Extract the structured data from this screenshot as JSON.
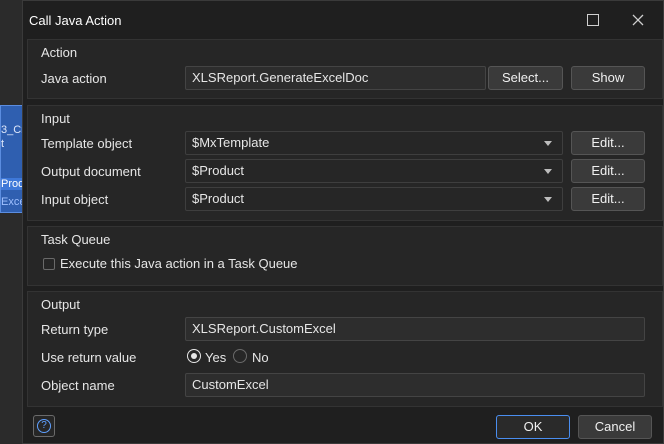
{
  "background_app": {
    "node_text_1": "3_Cre",
    "node_text_2": "t",
    "node_text_3": "Prod",
    "node_text_4": "Excel"
  },
  "window": {
    "title": "Call Java Action"
  },
  "action": {
    "group_title": "Action",
    "java_action_label": "Java action",
    "java_action_value": "XLSReport.GenerateExcelDoc",
    "select_button": "Select...",
    "show_button": "Show"
  },
  "input": {
    "group_title": "Input",
    "rows": [
      {
        "label": "Template object",
        "value": "$MxTemplate",
        "edit": "Edit..."
      },
      {
        "label": "Output document",
        "value": "$Product",
        "edit": "Edit..."
      },
      {
        "label": "Input object",
        "value": "$Product",
        "edit": "Edit..."
      }
    ]
  },
  "task_queue": {
    "group_title": "Task Queue",
    "checkbox_label": "Execute this Java action in a Task Queue"
  },
  "output": {
    "group_title": "Output",
    "return_type_label": "Return type",
    "return_type_value": "XLSReport.CustomExcel",
    "use_return_label": "Use return value",
    "yes_label": "Yes",
    "no_label": "No",
    "selected": "Yes",
    "object_name_label": "Object name",
    "object_name_value": "CustomExcel"
  },
  "footer": {
    "help_glyph": "?",
    "ok_button": "OK",
    "cancel_button": "Cancel"
  },
  "colors": {
    "dialog_bg": "#1f1f1f",
    "group_bg": "#262626",
    "ok_border": "#4a8ef0",
    "help_accent": "#5fa0ff"
  }
}
